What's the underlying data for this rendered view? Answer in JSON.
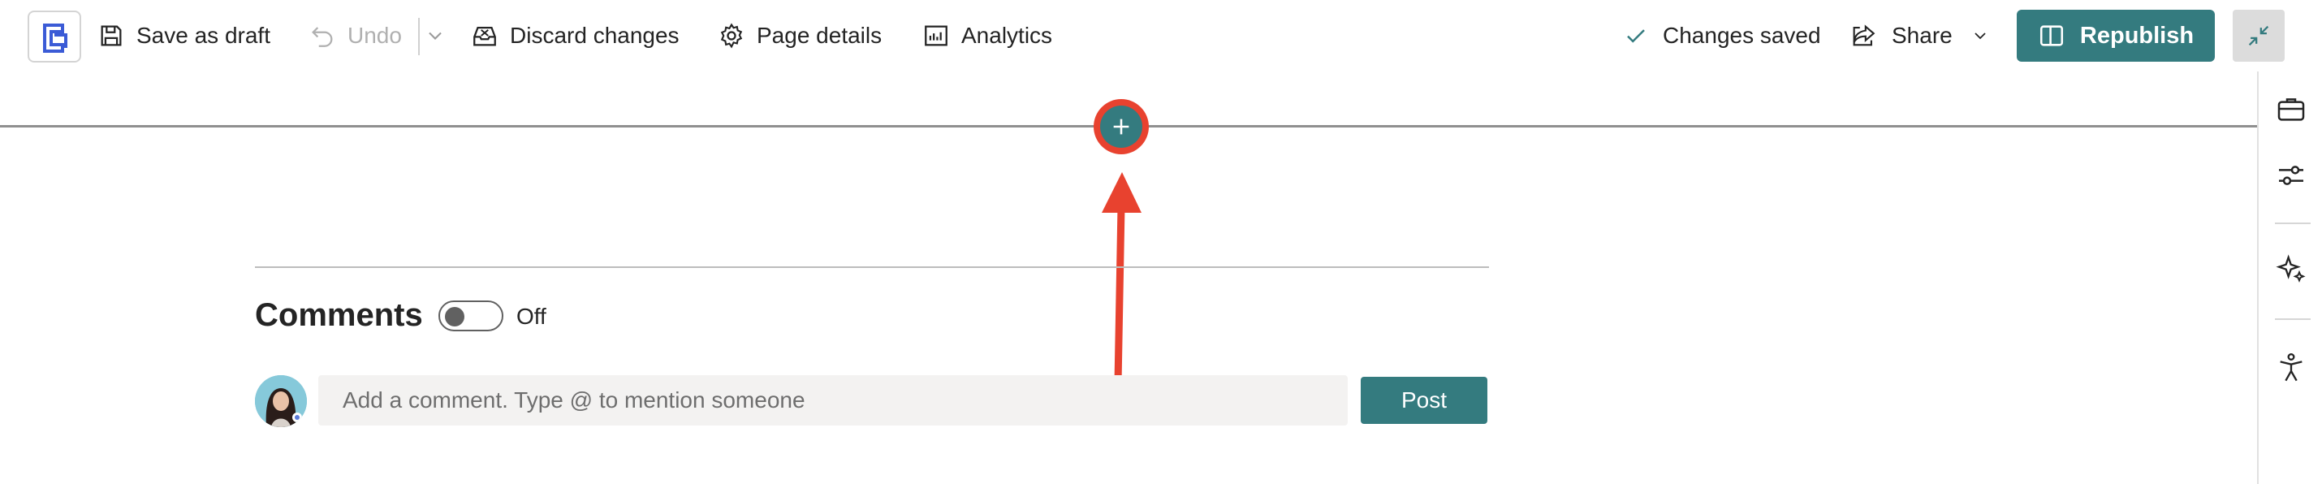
{
  "toolbar": {
    "save_draft_label": "Save as draft",
    "undo_label": "Undo",
    "discard_label": "Discard changes",
    "page_details_label": "Page details",
    "analytics_label": "Analytics",
    "status_label": "Changes saved",
    "share_label": "Share",
    "republish_label": "Republish"
  },
  "comments": {
    "title": "Comments",
    "toggle_state": "Off",
    "input_placeholder": "Add a comment. Type @ to mention someone",
    "post_label": "Post"
  },
  "colors": {
    "accent": "#347b7f",
    "annotation": "#e8422f"
  },
  "icons": [
    "save-icon",
    "undo-icon",
    "discard-icon",
    "gear-icon",
    "analytics-icon",
    "check-icon",
    "share-icon",
    "republish-icon",
    "collapse-icon",
    "briefcase-icon",
    "sliders-icon",
    "sparkle-icon",
    "accessibility-icon",
    "plus-icon"
  ]
}
